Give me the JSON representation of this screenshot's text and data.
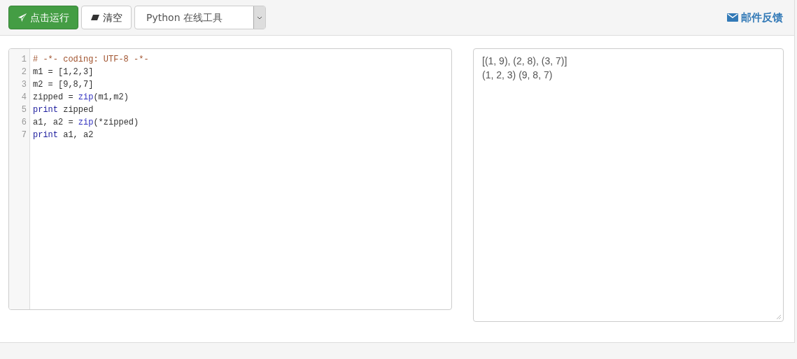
{
  "toolbar": {
    "run_button": "点击运行",
    "clear_button": "清空",
    "language_select": {
      "value": "Python 在线工具"
    },
    "feedback_link": "邮件反馈"
  },
  "editor": {
    "lines": [
      {
        "number": "1",
        "tokens": [
          {
            "kind": "comment",
            "text": "# -*- coding: UTF-8 -*-"
          }
        ]
      },
      {
        "number": "2",
        "tokens": [
          {
            "kind": "plain",
            "text": "m1 = [1,2,3]"
          }
        ]
      },
      {
        "number": "3",
        "tokens": [
          {
            "kind": "plain",
            "text": "m2 = [9,8,7]"
          }
        ]
      },
      {
        "number": "4",
        "tokens": [
          {
            "kind": "plain",
            "text": "zipped = "
          },
          {
            "kind": "builtin",
            "text": "zip"
          },
          {
            "kind": "plain",
            "text": "(m1,m2)"
          }
        ]
      },
      {
        "number": "5",
        "tokens": [
          {
            "kind": "keyword",
            "text": "print"
          },
          {
            "kind": "plain",
            "text": " zipped"
          }
        ]
      },
      {
        "number": "6",
        "tokens": [
          {
            "kind": "plain",
            "text": "a1, a2 = "
          },
          {
            "kind": "builtin",
            "text": "zip"
          },
          {
            "kind": "plain",
            "text": "(*zipped)"
          }
        ]
      },
      {
        "number": "7",
        "tokens": [
          {
            "kind": "keyword",
            "text": "print"
          },
          {
            "kind": "plain",
            "text": " a1, a2"
          }
        ]
      }
    ]
  },
  "output": {
    "lines": [
      "[(1, 9), (2, 8), (3, 7)]",
      "(1, 2, 3) (9, 8, 7)"
    ]
  }
}
